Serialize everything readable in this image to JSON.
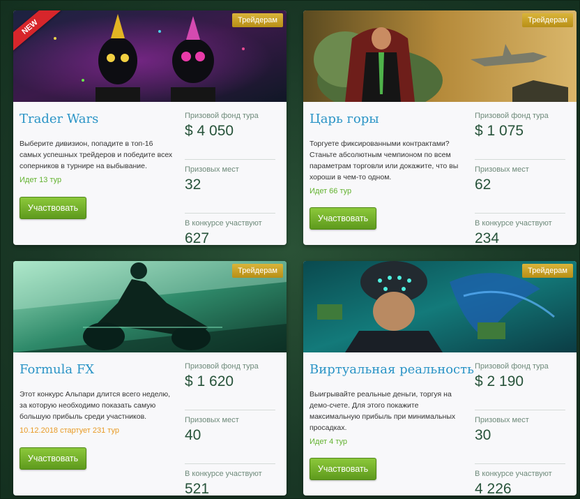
{
  "common": {
    "badge": "Трейдерам",
    "new_label": "NEW",
    "prize_label": "Призовой фонд тура",
    "places_label": "Призовых мест",
    "participants_label": "В конкурсе участвуют",
    "button_label": "Участвовать"
  },
  "cards": [
    {
      "title": "Trader Wars",
      "description": "Выберите дивизион, попадите в топ-16 самых успешных трейдеров и победите всех соперников в турнире на выбывание.",
      "status": "Идет 13 тур",
      "prize": "$ 4 050",
      "places": "32",
      "participants": "627"
    },
    {
      "title": "Царь горы",
      "description": "Торгуете фиксированными контрактами? Станьте абсолютным чемпионом по всем параметрам торговли или докажите, что вы хороши в чем-то одном.",
      "status": "Идет 66 тур",
      "prize": "$ 1 075",
      "places": "62",
      "participants": "234"
    },
    {
      "title": "Formula FX",
      "description": "Этот конкурс Альпари длится всего неделю, за которую необходимо показать самую большую прибыль среди участников.",
      "status": "10.12.2018 стартует 231 тур",
      "prize": "$ 1 620",
      "places": "40",
      "participants": "521"
    },
    {
      "title": "Виртуальная реальность",
      "description": "Выигрывайте реальные деньги, торгуя на демо-счете. Для этого покажите максимальную прибыль при минимальных просадках.",
      "status": "Идет 4 тур",
      "prize": "$ 2 190",
      "places": "30",
      "participants": "4 226"
    }
  ]
}
